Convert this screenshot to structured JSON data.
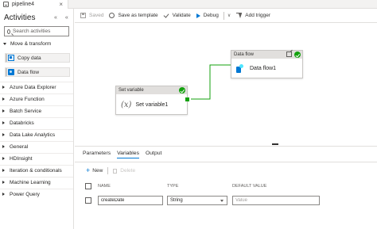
{
  "tab": {
    "label": "pipeline4",
    "close": "×"
  },
  "sidebar": {
    "title": "Activities",
    "controls": "« «",
    "search_placeholder": "Search activities",
    "expanded_category": "Move & transform",
    "items": [
      {
        "label": "Copy data",
        "icon": "copy-data-icon"
      },
      {
        "label": "Data flow",
        "icon": "data-flow-icon"
      }
    ],
    "categories": [
      "Azure Data Explorer",
      "Azure Function",
      "Batch Service",
      "Databricks",
      "Data Lake Analytics",
      "General",
      "HDInsight",
      "Iteration & conditionals",
      "Machine Learning",
      "Power Query"
    ]
  },
  "toolbar": {
    "saved": "Saved",
    "save_as_template": "Save as template",
    "validate": "Validate",
    "debug": "Debug",
    "add_trigger": "Add trigger"
  },
  "canvas": {
    "set_variable": {
      "header": "Set variable",
      "name": "Set variable1",
      "icon_text": "(x)"
    },
    "data_flow": {
      "header": "Data flow",
      "name": "Data flow1"
    }
  },
  "bottom": {
    "tabs": [
      "Parameters",
      "Variables",
      "Output"
    ],
    "active_tab": "Variables",
    "new_label": "New",
    "delete_label": "Delete",
    "columns": {
      "name": "NAME",
      "type": "TYPE",
      "default": "DEFAULT VALUE"
    },
    "row": {
      "name": "createDate",
      "type": "String",
      "default_placeholder": "Value"
    }
  },
  "colors": {
    "accent": "#0078d4",
    "success": "#13a10e",
    "header_gray": "#e1dfdd"
  }
}
